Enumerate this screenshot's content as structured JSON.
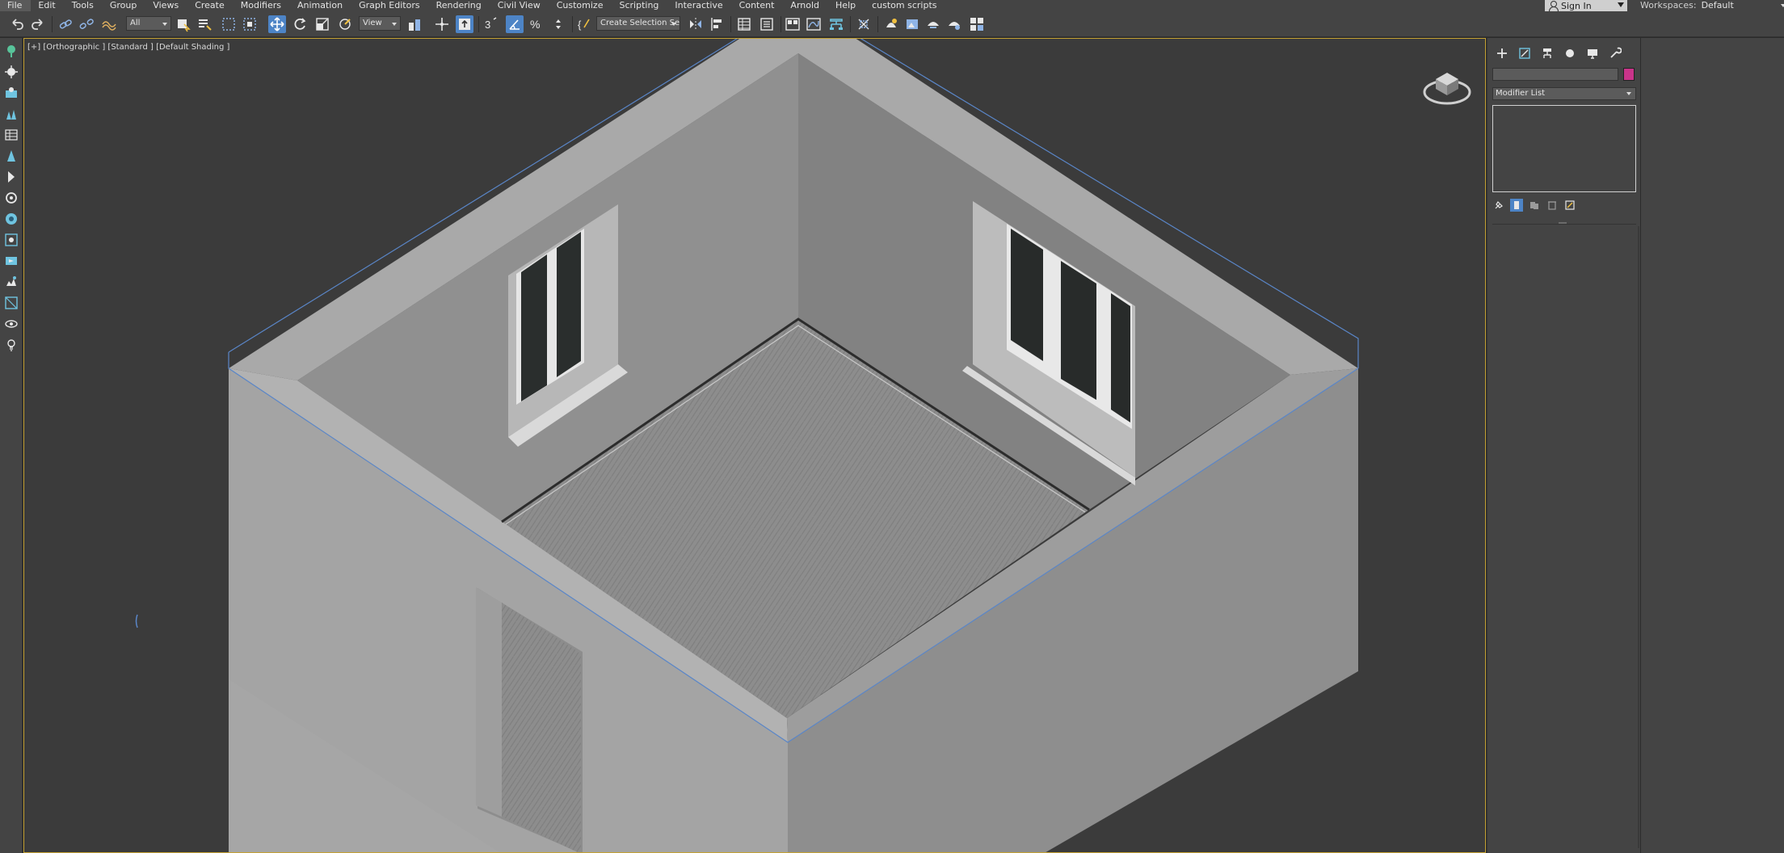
{
  "menu": [
    "File",
    "Edit",
    "Tools",
    "Group",
    "Views",
    "Create",
    "Modifiers",
    "Animation",
    "Graph Editors",
    "Rendering",
    "Civil View",
    "Customize",
    "Scripting",
    "Interactive",
    "Content",
    "Arnold",
    "Help",
    "custom scripts"
  ],
  "account": {
    "sign_in": "Sign In"
  },
  "workspaces": {
    "label": "Workspaces:",
    "value": "Default"
  },
  "toolbar": {
    "selection_filter": "All",
    "ref_coord": "View",
    "named_selection": "Create Selection Se"
  },
  "viewport": {
    "label": "[+] [Orthographic ] [Standard ] [Default Shading ]"
  },
  "command_panel": {
    "modifier_list": "Modifier List",
    "object_color": "#c9348a"
  },
  "colors": {
    "accent": "#4d84c6",
    "viewport_border": "#c4a133",
    "selection_bbox": "#5a86c8"
  },
  "icons": {
    "toolbar": [
      "undo-icon",
      "redo-icon",
      "link-icon",
      "unlink-icon",
      "bind-space-warp-icon",
      "select-object-icon",
      "select-by-name-icon",
      "rect-region-icon",
      "window-crossing-icon",
      "select-move-icon",
      "select-rotate-icon",
      "select-scale-icon",
      "placement-icon",
      "pivot-icon",
      "select-manipulate-icon",
      "keyboard-shortcut-icon",
      "snaps-3d-icon",
      "angle-snap-icon",
      "percent-snap-icon",
      "spinner-snap-icon",
      "edit-named-sets-icon",
      "mirror-icon",
      "align-icon",
      "scene-explorer-icon",
      "layer-explorer-icon",
      "toggle-ribbon-icon",
      "curve-editor-icon",
      "schematic-view-icon",
      "material-editor-icon",
      "render-setup-icon",
      "rendered-frame-icon",
      "render-production-icon",
      "render-online-icon",
      "render-iterative-icon"
    ],
    "leftbar": [
      "create-helper-icon",
      "create-light-icon",
      "scene-states-icon",
      "populate-icon",
      "mass-fx-icon",
      "perspective-match-icon",
      "orbit-icon",
      "particle-view-icon",
      "snaps-toggle-icon",
      "render-setup-side-icon",
      "physical-camera-icon",
      "environment-icon",
      "viewport-config-icon",
      "light-lister-icon"
    ],
    "command_tabs": [
      "create-tab-icon",
      "modify-tab-icon",
      "hierarchy-tab-icon",
      "motion-tab-icon",
      "display-tab-icon",
      "utilities-tab-icon"
    ],
    "stack_tools": [
      "pin-stack-icon",
      "show-end-result-icon",
      "make-unique-icon",
      "remove-modifier-icon",
      "configure-modifier-sets-icon"
    ]
  }
}
